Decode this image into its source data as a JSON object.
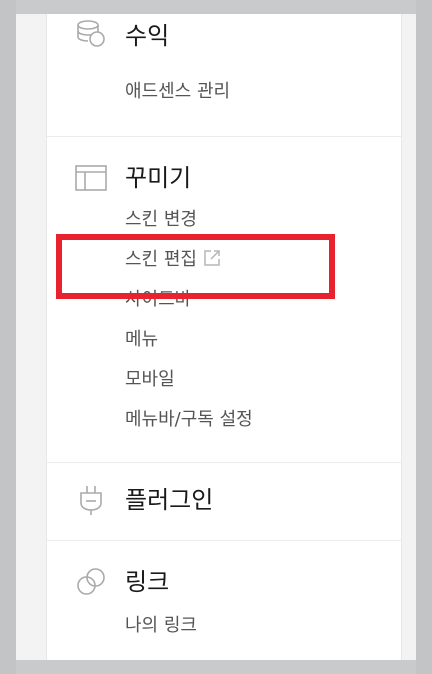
{
  "sections": [
    {
      "title": "수익",
      "icon": "coins-icon",
      "items": [
        "애드센스 관리"
      ]
    },
    {
      "title": "꾸미기",
      "icon": "layout-icon",
      "items": [
        "스킨 변경",
        "스킨 편집",
        "사이드바",
        "메뉴",
        "모바일",
        "메뉴바/구독 설정"
      ],
      "external_item_icon": "external-link-icon"
    },
    {
      "title": "플러그인",
      "icon": "plug-icon",
      "items": []
    },
    {
      "title": "링크",
      "icon": "link-icon",
      "items": [
        "나의 링크"
      ]
    }
  ],
  "highlight": {
    "target": "스킨 편집",
    "color": "#e8232f"
  }
}
